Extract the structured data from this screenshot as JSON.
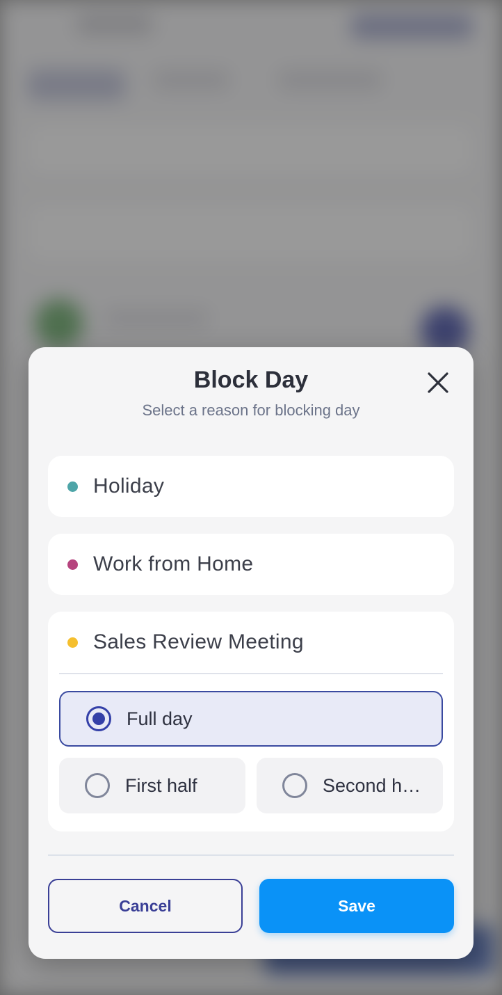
{
  "modal": {
    "title": "Block Day",
    "subtitle": "Select a reason for blocking day"
  },
  "options": [
    {
      "label": "Holiday",
      "dot_color": "#4ea5a8"
    },
    {
      "label": "Work from Home",
      "dot_color": "#b6447e"
    },
    {
      "label": "Sales Review Meeting",
      "dot_color": "#f5bf2e"
    }
  ],
  "duration": {
    "full_day": "Full day",
    "first_half": "First half",
    "second_half": "Second h…",
    "selected": "Full day"
  },
  "footer": {
    "cancel_label": "Cancel",
    "save_label": "Save"
  },
  "colors": {
    "accent": "#0a92f7",
    "primary": "#3a3f96"
  }
}
